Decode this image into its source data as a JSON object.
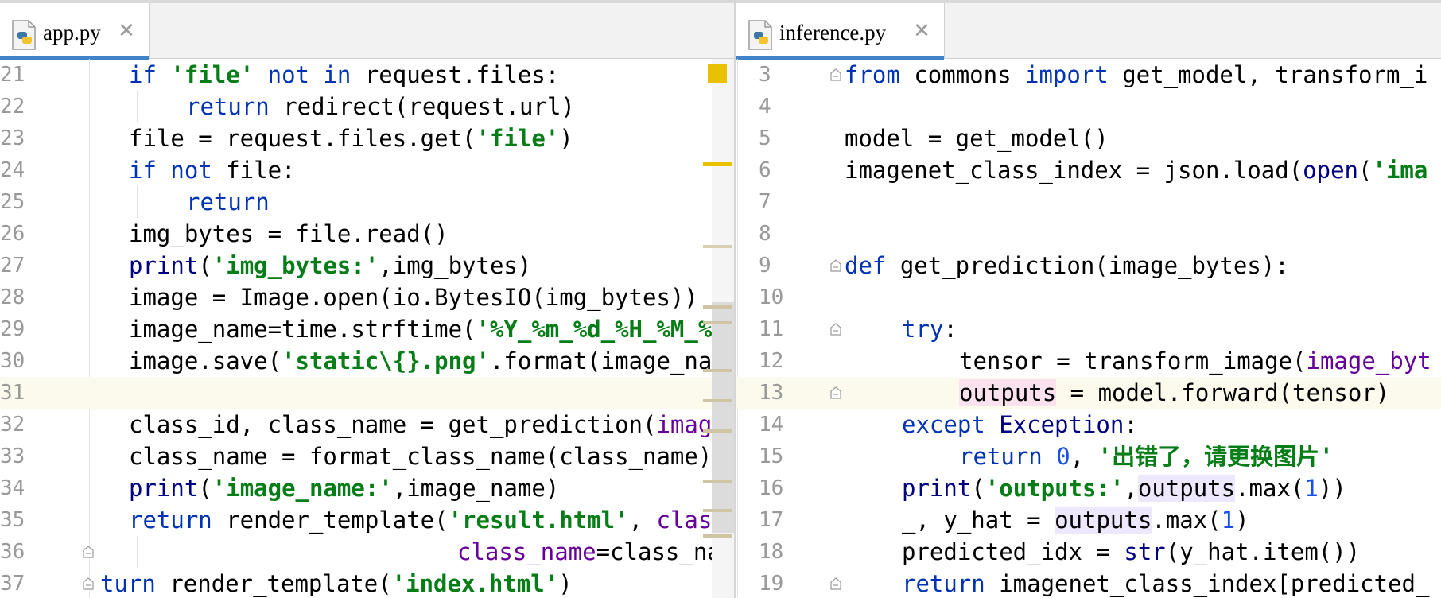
{
  "left_editor": {
    "tab": {
      "filename": "app.py",
      "icon": "python-file-icon",
      "close_icon": "close-icon"
    },
    "lines": [
      {
        "n": "21",
        "tokens": [
          {
            "t": "if ",
            "c": "kw"
          },
          {
            "t": "'file'",
            "c": "str"
          },
          {
            "t": " not in ",
            "c": "kw"
          },
          {
            "t": "request.files:"
          }
        ]
      },
      {
        "n": "22",
        "tokens": [
          {
            "t": "return ",
            "c": "kw"
          },
          {
            "t": "redirect(request.url)"
          }
        ]
      },
      {
        "n": "23",
        "tokens": [
          {
            "t": "file = request.files.get("
          },
          {
            "t": "'file'",
            "c": "str"
          },
          {
            "t": ")"
          }
        ]
      },
      {
        "n": "24",
        "tokens": [
          {
            "t": "if not ",
            "c": "kw"
          },
          {
            "t": "file:"
          }
        ]
      },
      {
        "n": "25",
        "tokens": [
          {
            "t": "return",
            "c": "kw"
          }
        ]
      },
      {
        "n": "26",
        "tokens": [
          {
            "t": "img_bytes = file.read()"
          }
        ]
      },
      {
        "n": "27",
        "tokens": [
          {
            "t": "print",
            "c": "bi"
          },
          {
            "t": "("
          },
          {
            "t": "'img_bytes:'",
            "c": "str"
          },
          {
            "t": ",img_bytes)"
          }
        ]
      },
      {
        "n": "28",
        "tokens": [
          {
            "t": "image = Image.open(io.BytesIO(img_bytes))"
          }
        ]
      },
      {
        "n": "29",
        "tokens": [
          {
            "t": "image_name=time.strftime("
          },
          {
            "t": "'%Y_%m_%d_%H_%M_%",
            "c": "str"
          }
        ]
      },
      {
        "n": "30",
        "tokens": [
          {
            "t": "image.save("
          },
          {
            "t": "'static\\{}.png'",
            "c": "str"
          },
          {
            "t": ".format(image_na"
          }
        ]
      },
      {
        "n": "31",
        "tokens": []
      },
      {
        "n": "32",
        "tokens": [
          {
            "t": "class_id, class_name = get_prediction("
          },
          {
            "t": "image",
            "c": "kwarg"
          }
        ]
      },
      {
        "n": "33",
        "tokens": [
          {
            "t": "class_name = format_class_name(class_name)"
          }
        ]
      },
      {
        "n": "34",
        "tokens": [
          {
            "t": "print",
            "c": "bi"
          },
          {
            "t": "("
          },
          {
            "t": "'image_name:'",
            "c": "str"
          },
          {
            "t": ",image_name)"
          }
        ]
      },
      {
        "n": "35",
        "tokens": [
          {
            "t": "return ",
            "c": "kw"
          },
          {
            "t": "render_template("
          },
          {
            "t": "'result.html'",
            "c": "str"
          },
          {
            "t": ", "
          },
          {
            "t": "clas",
            "c": "kwarg"
          }
        ]
      },
      {
        "n": "36",
        "tokens": [
          {
            "t": "class_name",
            "c": "kwarg"
          },
          {
            "t": "=class_nar"
          }
        ]
      },
      {
        "n": "37",
        "tokens": [
          {
            "t": "turn ",
            "c": "kw"
          },
          {
            "t": "render_template("
          },
          {
            "t": "'index.html'",
            "c": "str"
          },
          {
            "t": ")"
          }
        ]
      }
    ]
  },
  "right_editor": {
    "tab": {
      "filename": "inference.py",
      "icon": "python-file-icon",
      "close_icon": "close-icon"
    },
    "lines": [
      {
        "n": "3",
        "tokens": [
          {
            "t": "from ",
            "c": "kw"
          },
          {
            "t": "commons "
          },
          {
            "t": "import ",
            "c": "kw"
          },
          {
            "t": "get_model, transform_i"
          }
        ]
      },
      {
        "n": "4",
        "tokens": []
      },
      {
        "n": "5",
        "tokens": [
          {
            "t": "model = get_model()"
          }
        ]
      },
      {
        "n": "6",
        "tokens": [
          {
            "t": "imagenet_class_index = json.load("
          },
          {
            "t": "open",
            "c": "bi"
          },
          {
            "t": "("
          },
          {
            "t": "'ima",
            "c": "str"
          }
        ]
      },
      {
        "n": "7",
        "tokens": []
      },
      {
        "n": "8",
        "tokens": []
      },
      {
        "n": "9",
        "tokens": [
          {
            "t": "def ",
            "c": "kw"
          },
          {
            "t": "get_prediction(image_bytes):"
          }
        ]
      },
      {
        "n": "10",
        "tokens": []
      },
      {
        "n": "11",
        "tokens": [
          {
            "t": "try",
            "c": "kw"
          },
          {
            "t": ":"
          }
        ]
      },
      {
        "n": "12",
        "tokens": [
          {
            "t": "tensor = transform_image("
          },
          {
            "t": "image_byt",
            "c": "kwarg"
          }
        ]
      },
      {
        "n": "13",
        "tokens": [
          {
            "t": "outputs",
            "h": "hl-write"
          },
          {
            "t": " = model.forward(tensor)"
          }
        ]
      },
      {
        "n": "14",
        "tokens": [
          {
            "t": "except ",
            "c": "kw"
          },
          {
            "t": "Exception",
            "c": "bi"
          },
          {
            "t": ":"
          }
        ]
      },
      {
        "n": "15",
        "tokens": [
          {
            "t": "return ",
            "c": "kw"
          },
          {
            "t": "0",
            "c": "num"
          },
          {
            "t": ", "
          },
          {
            "t": "'出错了，请更换图片'",
            "c": "str"
          }
        ]
      },
      {
        "n": "16",
        "tokens": [
          {
            "t": "print",
            "c": "bi"
          },
          {
            "t": "("
          },
          {
            "t": "'outputs:'",
            "c": "str"
          },
          {
            "t": ","
          },
          {
            "t": "outputs",
            "h": "hl-read"
          },
          {
            "t": ".max("
          },
          {
            "t": "1",
            "c": "num"
          },
          {
            "t": "))"
          }
        ]
      },
      {
        "n": "17",
        "tokens": [
          {
            "t": "_, y_hat = "
          },
          {
            "t": "outputs",
            "h": "hl-read"
          },
          {
            "t": ".max("
          },
          {
            "t": "1",
            "c": "num"
          },
          {
            "t": ")"
          }
        ]
      },
      {
        "n": "18",
        "tokens": [
          {
            "t": "predicted_idx = "
          },
          {
            "t": "str",
            "c": "bi"
          },
          {
            "t": "(y_hat.item())"
          }
        ]
      },
      {
        "n": "19",
        "tokens": [
          {
            "t": "return ",
            "c": "kw"
          },
          {
            "t": "imagenet_class_index[predicted_"
          }
        ]
      }
    ]
  }
}
